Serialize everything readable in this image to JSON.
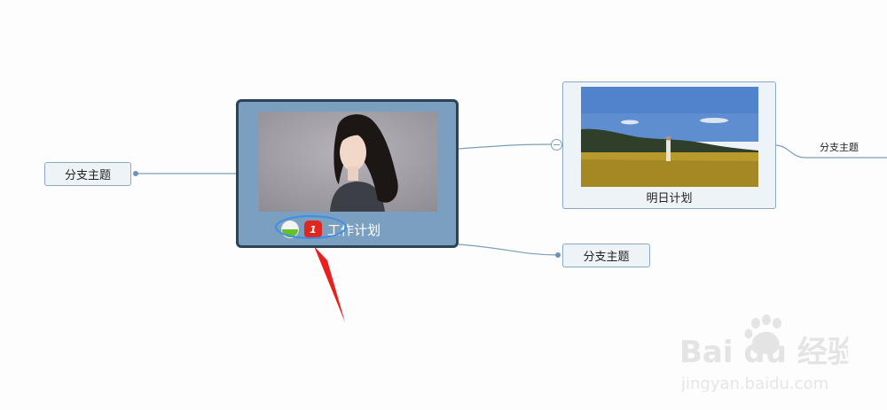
{
  "mindmap": {
    "central_topic": {
      "title": "工作计划",
      "markers": [
        {
          "icon": "progress-half-icon",
          "value": 0.5,
          "color": "#66c02e"
        },
        {
          "icon": "priority-1-icon",
          "label": "1",
          "color": "#e0261f"
        }
      ],
      "fill_color": "#7a9fbf",
      "border_color": "#2d4257",
      "image": "portrait-photo"
    },
    "left_branch": {
      "title": "分支主题"
    },
    "bottom_right_branch": {
      "title": "分支主题"
    },
    "image_topic": {
      "title": "明日计划",
      "image": "grassland-landscape-photo"
    },
    "far_right_subtopic": {
      "title": "分支主题"
    },
    "selection_highlight_color": "#3a8ee6",
    "annotation_arrow_color": "#e8201e"
  },
  "watermark": {
    "brand": "Bai du 经验",
    "url": "jingyan.baidu.com"
  }
}
